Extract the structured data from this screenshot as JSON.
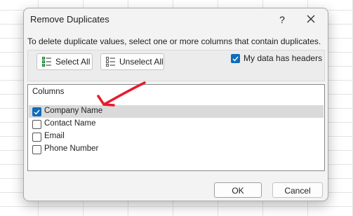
{
  "dialog": {
    "title": "Remove Duplicates",
    "help_label": "?",
    "description": "To delete duplicate values, select one or more columns that contain duplicates.",
    "select_all_label": "Select All",
    "unselect_all_label": "Unselect All",
    "headers_checkbox_label": "My data has headers",
    "headers_checked": true,
    "columns_header": "Columns",
    "columns": [
      {
        "label": "Company Name",
        "checked": true
      },
      {
        "label": "Contact Name",
        "checked": false
      },
      {
        "label": "Email",
        "checked": false
      },
      {
        "label": "Phone Number",
        "checked": false
      }
    ],
    "ok_label": "OK",
    "cancel_label": "Cancel"
  },
  "colors": {
    "accent": "#0f6cbd",
    "annotation_arrow": "#e8192c"
  }
}
